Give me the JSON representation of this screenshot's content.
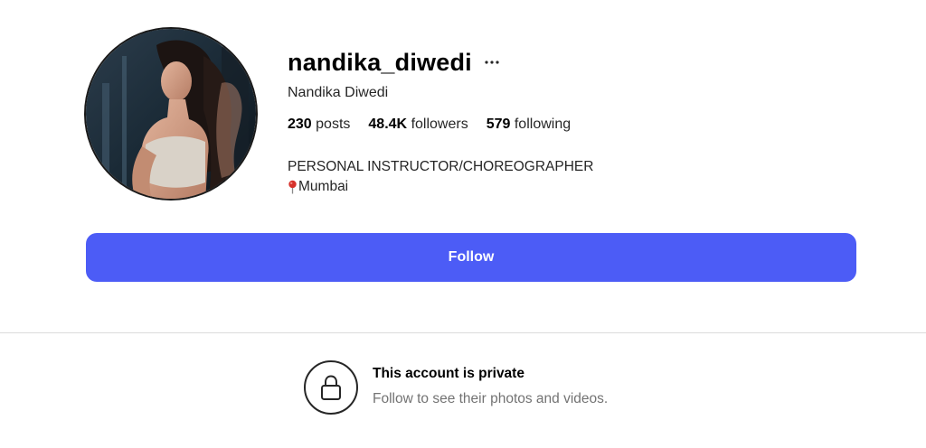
{
  "profile": {
    "username": "nandika_diwedi",
    "full_name": "Nandika Diwedi",
    "avatar_alt": "profile picture",
    "stats": {
      "posts_count": "230",
      "posts_label": "posts",
      "followers_count": "48.4K",
      "followers_label": "followers",
      "following_count": "579",
      "following_label": "following"
    },
    "bio": {
      "line1": "PERSONAL INSTRUCTOR/CHOREOGRAPHER",
      "location": "Mumbai",
      "location_icon": "round-pushpin-icon"
    },
    "more_icon": "ellipsis-icon"
  },
  "actions": {
    "follow_label": "Follow",
    "follow_color": "#4c5cf6"
  },
  "private_notice": {
    "icon": "lock-icon",
    "title": "This account is private",
    "subtitle": "Follow to see their photos and videos."
  }
}
